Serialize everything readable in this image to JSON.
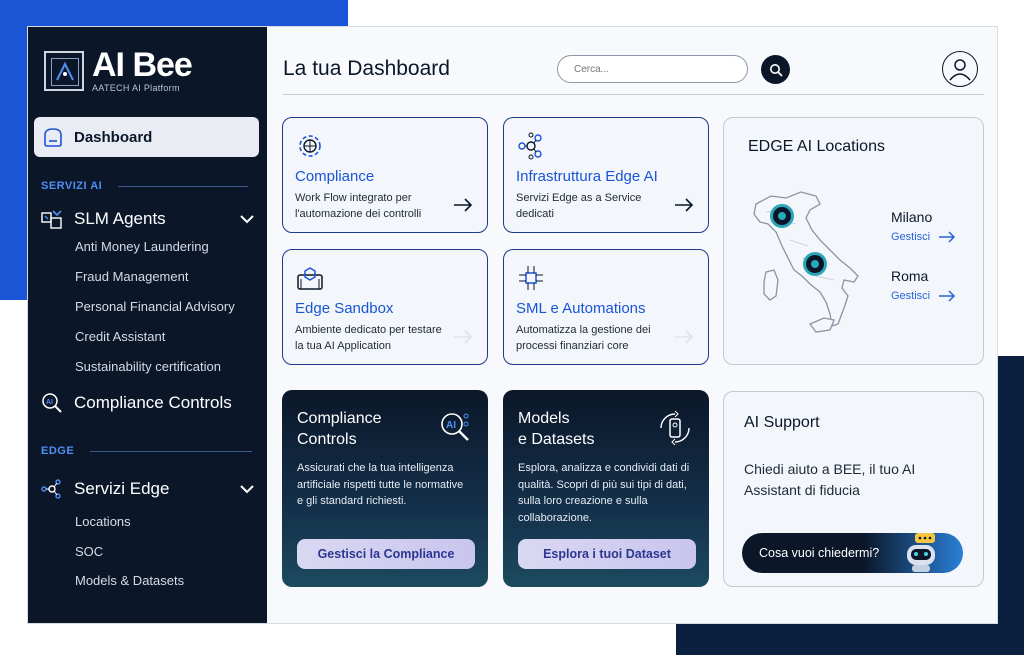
{
  "brand": {
    "title": "AI Bee",
    "subtitle": "AATECH AI Platform"
  },
  "sidebar": {
    "dashboard_label": "Dashboard",
    "section_ai": "SERVIZI AI",
    "slm_agents": {
      "label": "SLM Agents",
      "items": [
        "Anti Money Laundering",
        "Fraud Management",
        "Personal Financial Advisory",
        "Credit Assistant",
        "Sustainability certification"
      ]
    },
    "compliance_controls": "Compliance Controls",
    "section_edge": "EDGE",
    "servizi_edge": {
      "label": "Servizi Edge",
      "items": [
        "Locations",
        "SOC",
        "Models & Datasets"
      ]
    }
  },
  "header": {
    "title": "La tua Dashboard",
    "search_placeholder": "Cerca..."
  },
  "cards": [
    {
      "title": "Compliance",
      "desc": "Work Flow integrato per l'automazione dei controlli",
      "icon": "gear-globe-icon",
      "arrow_active": true
    },
    {
      "title": "Infrastruttura Edge AI",
      "desc": "Servizi Edge as a Service dedicati",
      "icon": "network-icon",
      "arrow_active": true
    },
    {
      "title": "Edge Sandbox",
      "desc": "Ambiente dedicato per testare la tua AI Application",
      "icon": "sandbox-cube-icon",
      "arrow_active": false
    },
    {
      "title": "SML e Automations",
      "desc": "Automatizza la gestione dei processi finanziari core",
      "icon": "circuit-icon",
      "arrow_active": false
    }
  ],
  "locations": {
    "title": "EDGE AI Locations",
    "items": [
      {
        "name": "Milano",
        "link": "Gestisci"
      },
      {
        "name": "Roma",
        "link": "Gestisci"
      }
    ]
  },
  "dark_cards": [
    {
      "title_line1": "Compliance",
      "title_line2": "Controls",
      "desc": "Assicurati che la tua intelligenza artificiale rispetti tutte le normative e gli standard richiesti.",
      "button": "Gestisci la Compliance",
      "icon": "ai-search-icon"
    },
    {
      "title_line1": "Models",
      "title_line2": "e Datasets",
      "desc": "Esplora, analizza e condividi dati di qualità. Scopri di più sui tipi di dati, sulla loro creazione e sulla collaborazione.",
      "button": "Esplora i tuoi Dataset",
      "icon": "device-sync-icon"
    }
  ],
  "support": {
    "title": "AI Support",
    "text": "Chiedi aiuto a BEE, il tuo AI Assistant di fiducia",
    "ask_label": "Cosa vuoi chiedermi?"
  },
  "colors": {
    "accent": "#1a55d6",
    "navy": "#0b1729",
    "teal": "#2aa7b8"
  }
}
